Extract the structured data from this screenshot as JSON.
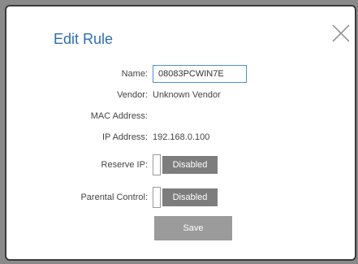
{
  "dialog": {
    "title": "Edit Rule",
    "close_icon": "close-icon"
  },
  "fields": {
    "name": {
      "label": "Name:",
      "value": "08083PCWIN7E"
    },
    "vendor": {
      "label": "Vendor:",
      "value": "Unknown Vendor"
    },
    "mac": {
      "label": "MAC Address:",
      "value": ""
    },
    "ip": {
      "label": "IP Address:",
      "value": "192.168.0.100"
    },
    "reserve_ip": {
      "label": "Reserve IP:",
      "state": "Disabled"
    },
    "parental_control": {
      "label": "Parental Control:",
      "state": "Disabled"
    }
  },
  "actions": {
    "save_label": "Save"
  },
  "colors": {
    "title": "#2b6fb5",
    "toggle_off": "#7d7d7d",
    "save_button": "#9b9b9b",
    "input_border": "#4a90d9"
  }
}
